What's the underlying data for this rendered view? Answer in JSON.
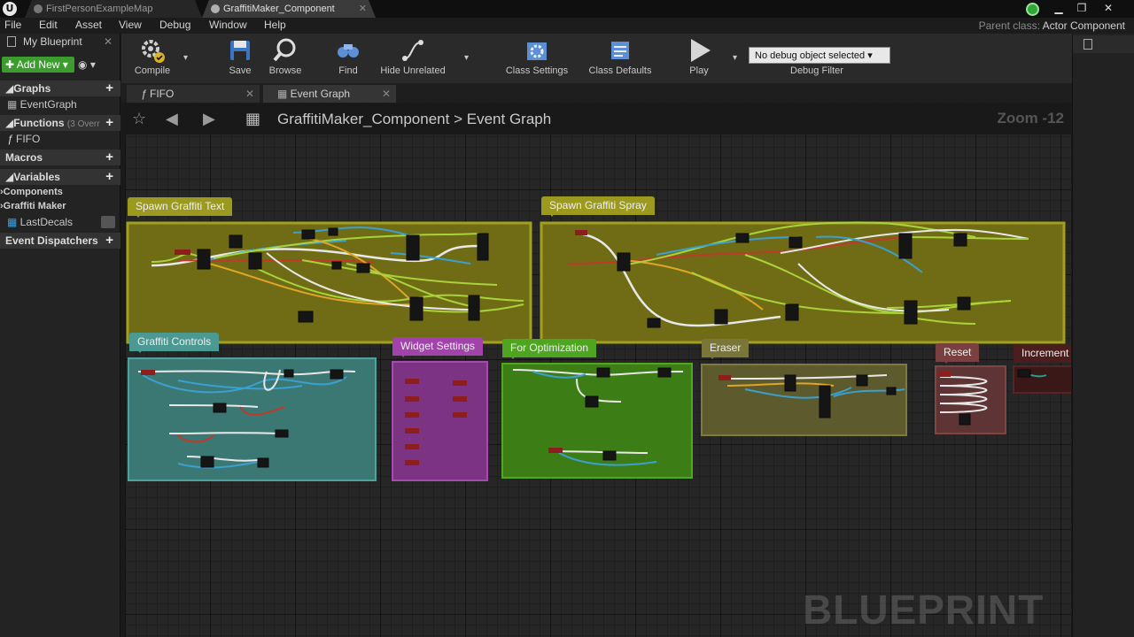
{
  "window": {
    "tabs": [
      {
        "label": "FirstPersonExampleMap",
        "active": false
      },
      {
        "label": "GraffitiMaker_Component",
        "active": true
      }
    ],
    "parent_class_label": "Parent class:",
    "parent_class_value": "Actor Component"
  },
  "menu": [
    "File",
    "Edit",
    "Asset",
    "View",
    "Debug",
    "Window",
    "Help"
  ],
  "left_panel": {
    "title": "My Blueprint",
    "add_new": "Add New",
    "sections": {
      "graphs": "Graphs",
      "graph_item": "EventGraph",
      "functions": "Functions",
      "functions_note": "(3 Overr",
      "function_item": "FIFO",
      "macros": "Macros",
      "variables": "Variables",
      "var_cat_components": "Components",
      "var_cat_graffiti": "Graffiti Maker",
      "var_item": "LastDecals",
      "dispatchers": "Event Dispatchers"
    }
  },
  "toolbar": {
    "compile": "Compile",
    "save": "Save",
    "browse": "Browse",
    "find": "Find",
    "hide_unrelated": "Hide Unrelated",
    "class_settings": "Class Settings",
    "class_defaults": "Class Defaults",
    "play": "Play",
    "debug_select": "No debug object selected",
    "debug_label": "Debug Filter"
  },
  "doc_tabs": [
    "FIFO",
    "Event Graph"
  ],
  "graph": {
    "breadcrumb_root": "GraffitiMaker_Component",
    "breadcrumb_sep": ">",
    "breadcrumb_leaf": "Event Graph",
    "zoom": "Zoom -12",
    "watermark": "BLUEPRINT"
  },
  "comments": [
    {
      "id": "spawn-text",
      "label": "Spawn Graffiti Text",
      "color": "#7d7a12"
    },
    {
      "id": "spawn-spray",
      "label": "Spawn Graffiti Spray",
      "color": "#7d7a12"
    },
    {
      "id": "controls",
      "label": "Graffiti Controls",
      "color": "#3f8b85"
    },
    {
      "id": "widget",
      "label": "Widget Settings",
      "color": "#8c3d93"
    },
    {
      "id": "optim",
      "label": "For Optimization",
      "color": "#3f8d1a"
    },
    {
      "id": "eraser",
      "label": "Eraser",
      "color": "#6a6633"
    },
    {
      "id": "reset",
      "label": "Reset",
      "color": "#6e3a3a"
    },
    {
      "id": "increment",
      "label": "Increment",
      "color": "#4b1d1d"
    }
  ]
}
